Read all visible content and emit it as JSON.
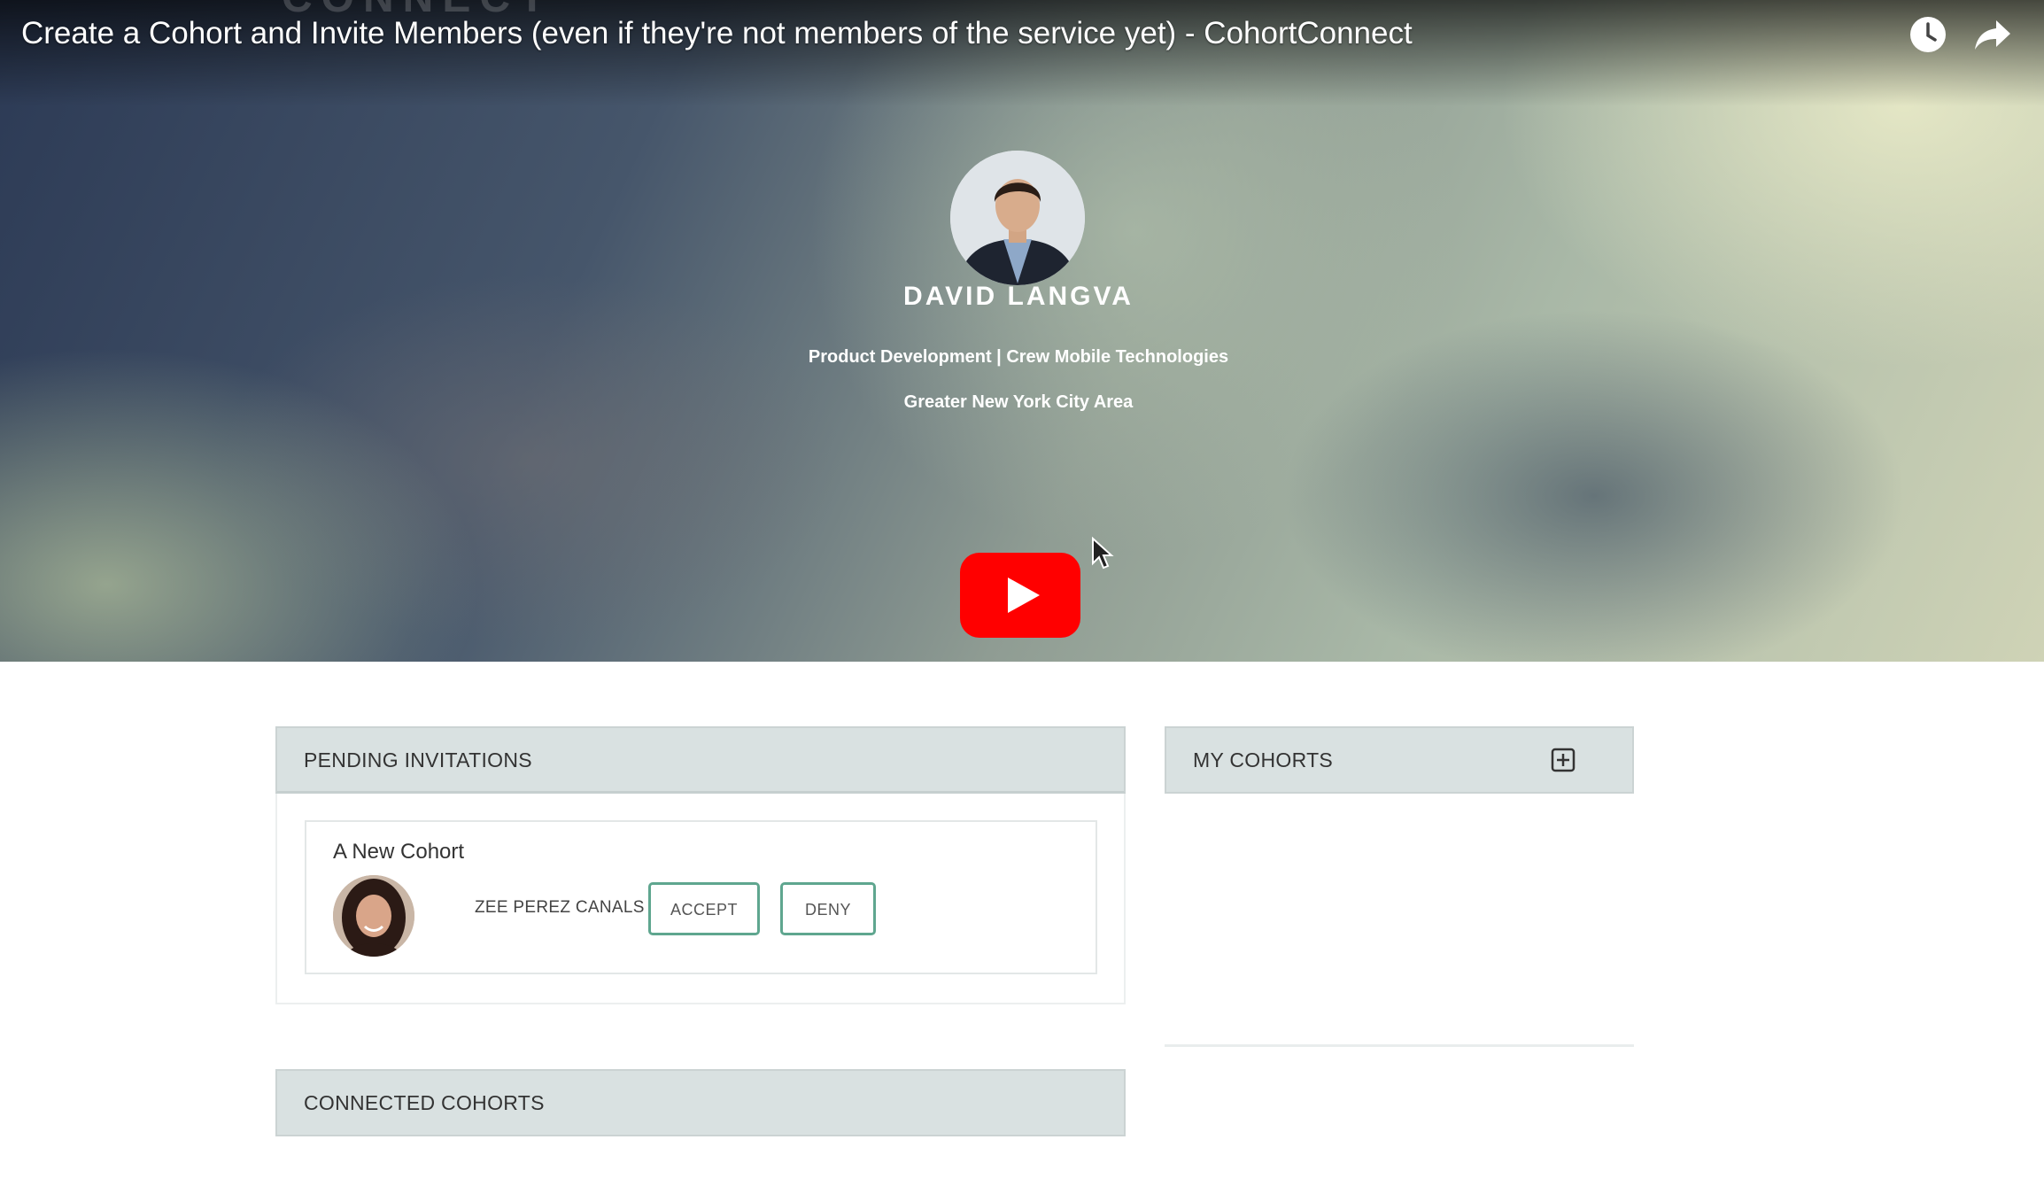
{
  "video": {
    "title": "Create a Cohort and Invite Members (even if they're not members of the service yet) - CohortConnect",
    "ghost_logo_text": "CONNECT",
    "watch_later_icon": "clock-icon",
    "share_icon": "share-arrow-icon",
    "play_icon": "youtube-play-icon",
    "play_color": "#ff0000"
  },
  "profile": {
    "name": "DAVID LANGVA",
    "role": "Product Development | Crew Mobile Technologies",
    "location": "Greater New York City Area"
  },
  "pending_invitations": {
    "header": "PENDING INVITATIONS",
    "invitations": [
      {
        "cohort_name": "A New Cohort",
        "inviter_name": "ZEE PEREZ CANALS",
        "accept_label": "ACCEPT",
        "deny_label": "DENY"
      }
    ]
  },
  "my_cohorts": {
    "header": "MY COHORTS",
    "add_icon": "plus-square-icon"
  },
  "connected_cohorts": {
    "header": "CONNECTED COHORTS"
  },
  "colors": {
    "panel_header_bg": "#d9e1e1",
    "button_border": "#5fa68f"
  }
}
